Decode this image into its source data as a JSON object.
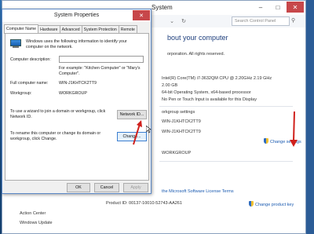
{
  "system_window": {
    "title": "System",
    "search_placeholder": "Search Control Panel",
    "heading": "bout your computer",
    "copyright_lines": [
      "orporation. All rights reserved."
    ],
    "specs": [
      "Intel(R) Core(TM) i7-3632QM CPU @ 2.20GHz   2.19 GHz",
      "2.00 GB",
      "64-bit Operating System, x64-based processor",
      "No Pen or Touch Input is available for this Display"
    ],
    "section_workgroup": "orkgroup settings",
    "names": [
      "WIN-J1KHTCK2TT9",
      "WIN-J1KHTCK2TT9"
    ],
    "workgroup": "WORKGROUP",
    "change_settings": "Change settings",
    "license_link": "the Microsoft Software License Terms",
    "product_id": "Product ID: 00137-10010-52743-AA261",
    "change_key": "Change product key",
    "see_also": [
      "Action Center",
      "Windows Update"
    ]
  },
  "dialog": {
    "title": "System Properties",
    "close": "✕",
    "tabs": [
      "Computer Name",
      "Hardware",
      "Advanced",
      "System Protection",
      "Remote"
    ],
    "intro": "Windows uses the following information to identify your computer on the network.",
    "desc_label": "Computer description:",
    "desc_value": "",
    "desc_example": "For example: \"Kitchen Computer\" or \"Mary's Computer\".",
    "fullname_label": "Full computer name:",
    "fullname_value": "WIN-J1KHTCK2TT9",
    "workgroup_label": "Workgroup:",
    "workgroup_value": "WORKGROUP",
    "wizard_text": "To use a wizard to join a domain or workgroup, click Network ID.",
    "network_id": "Network ID...",
    "rename_text": "To rename this computer or change its domain or workgroup, click Change.",
    "change": "Change...",
    "ok": "OK",
    "cancel": "Cancel",
    "apply": "Apply"
  },
  "colors": {
    "accent_link": "#1a5ab0",
    "arrow": "#d0201c"
  }
}
